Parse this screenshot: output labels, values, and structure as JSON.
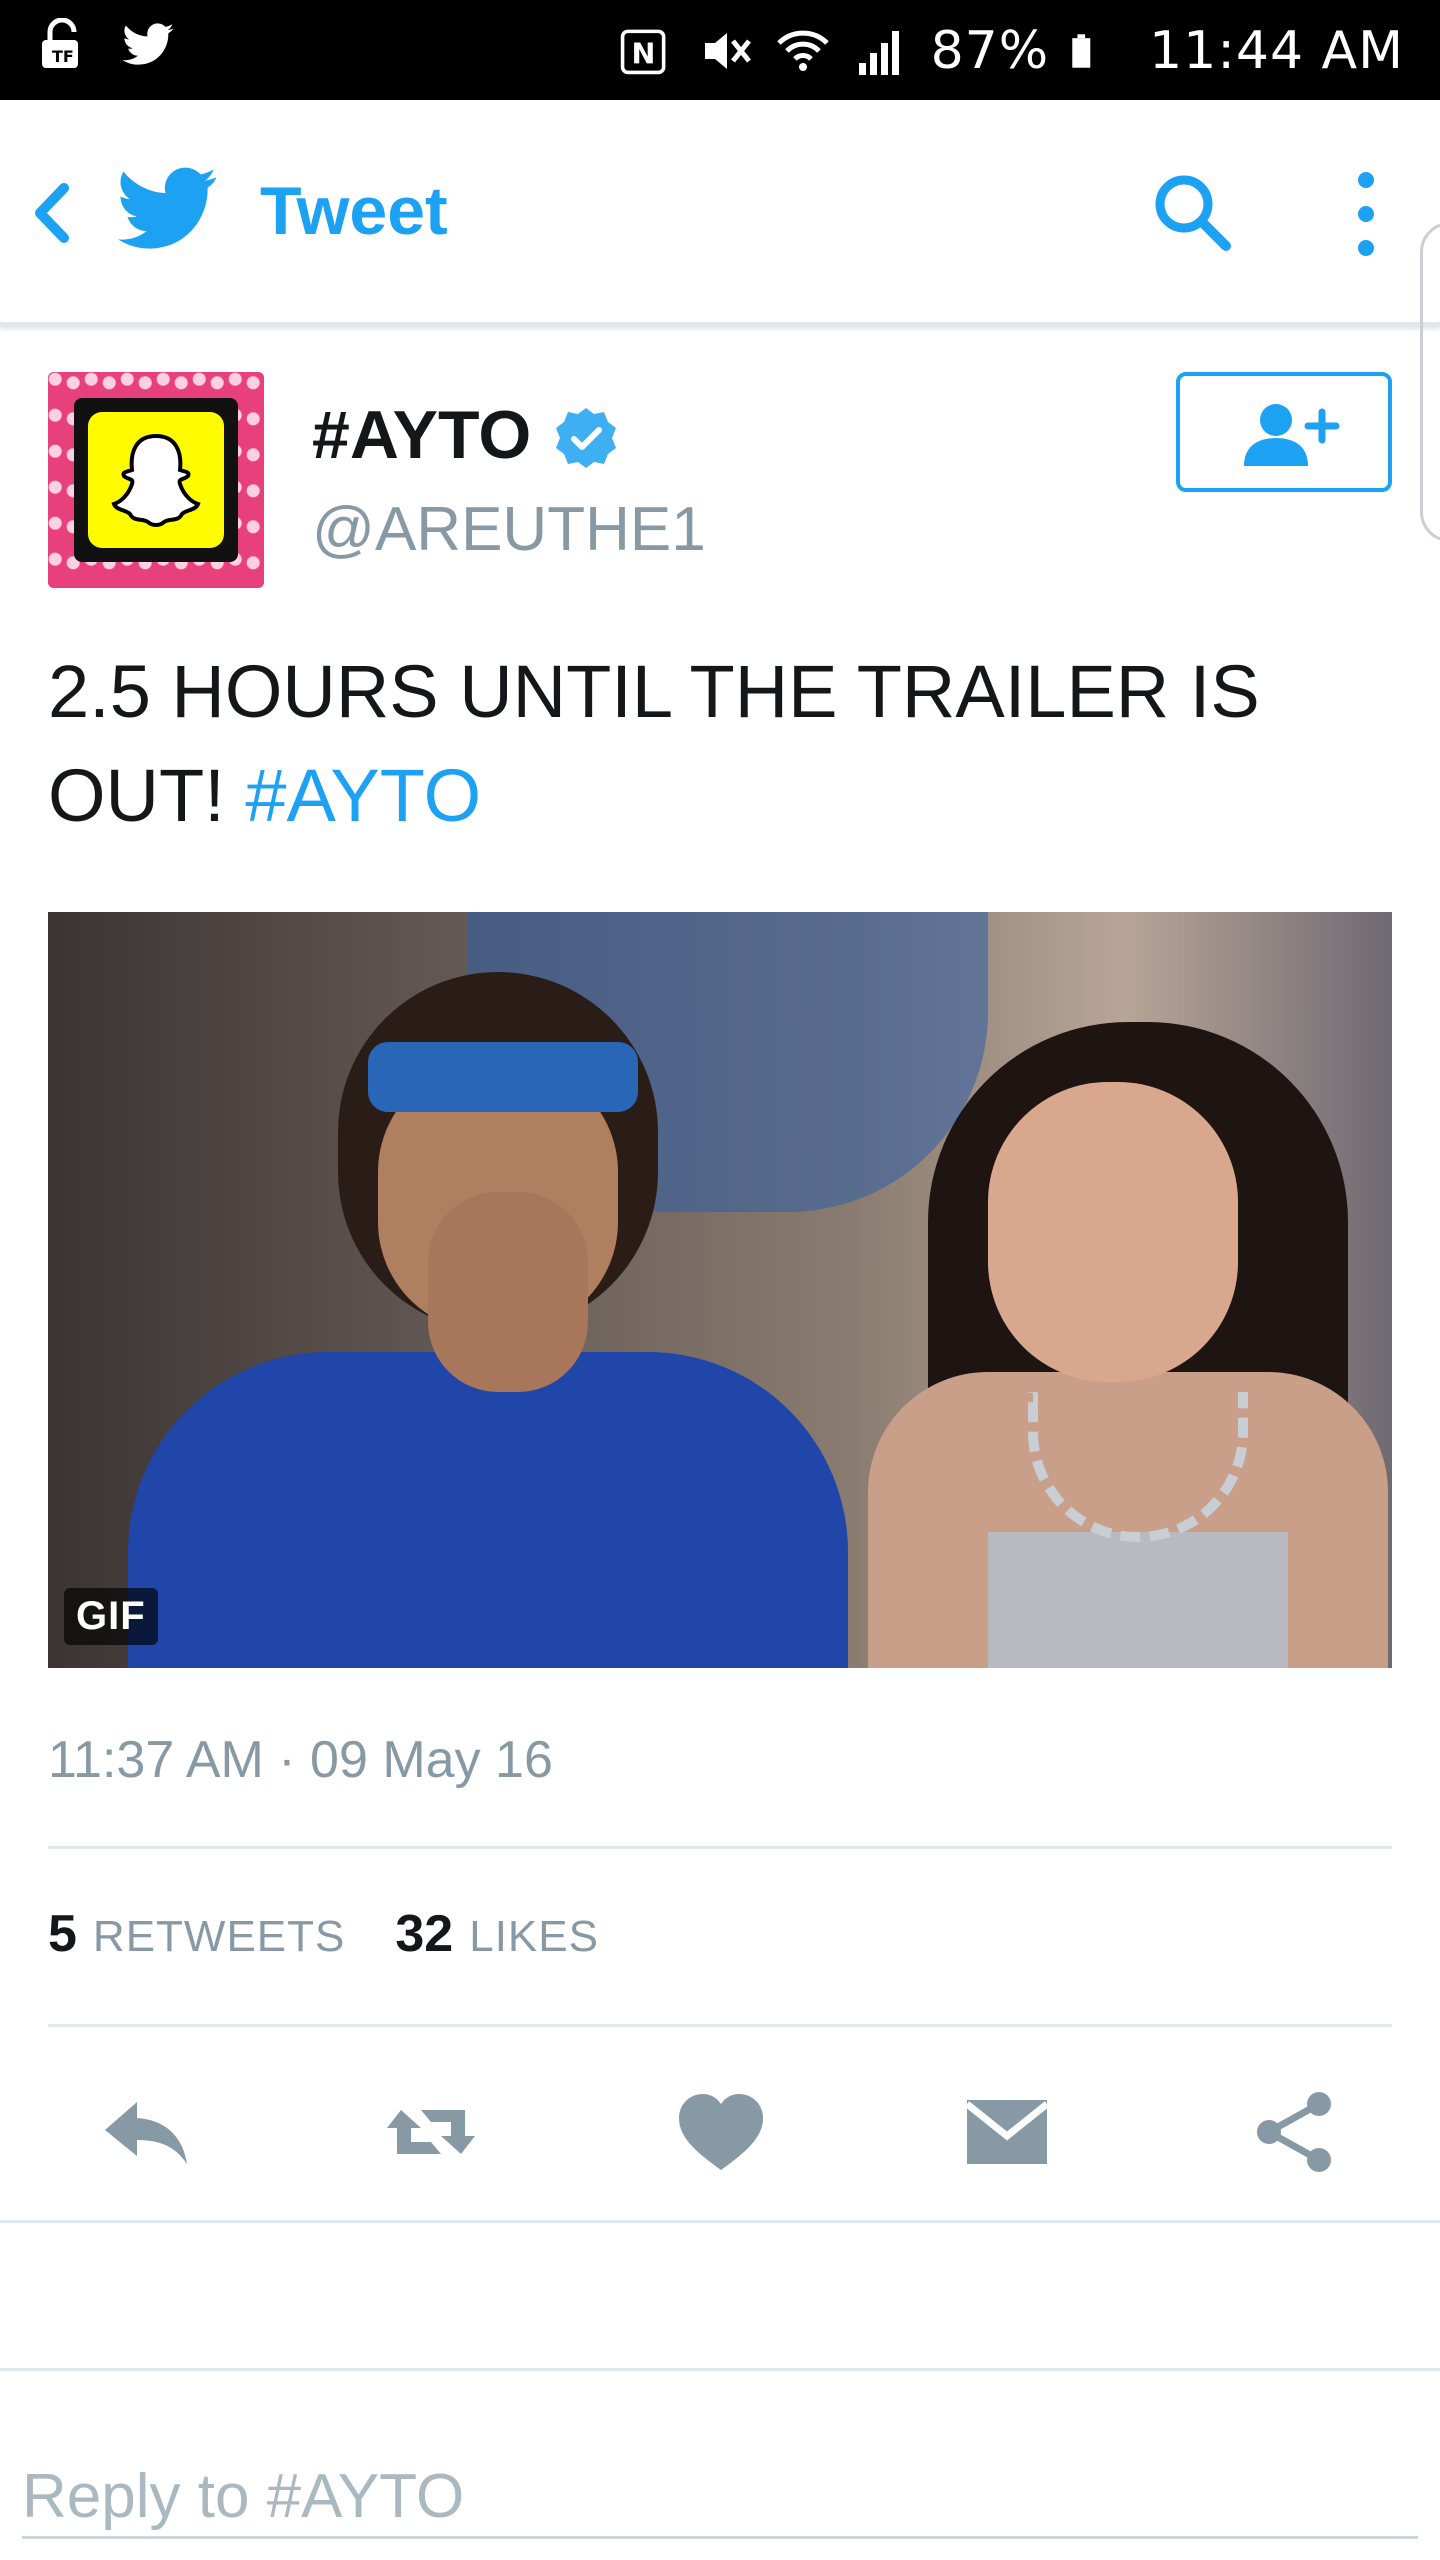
{
  "status_bar": {
    "battery": "87%",
    "time": "11:44 AM"
  },
  "app_bar": {
    "title": "Tweet"
  },
  "tweet": {
    "display_name": "#AYTO",
    "handle": "@AREUTHE1",
    "text_main": "2.5 HOURS UNTIL THE TRAILER IS OUT! ",
    "text_hashtag": "#AYTO",
    "media_badge": "GIF",
    "timestamp": "11:37 AM · 09 May 16"
  },
  "stats": {
    "retweets_count": "5",
    "retweets_label": "RETWEETS",
    "likes_count": "32",
    "likes_label": "LIKES"
  },
  "reply": {
    "placeholder": "Reply to #AYTO"
  },
  "colors": {
    "accent": "#1da1f2",
    "muted": "#8899a6",
    "icon": "#8899a6"
  }
}
